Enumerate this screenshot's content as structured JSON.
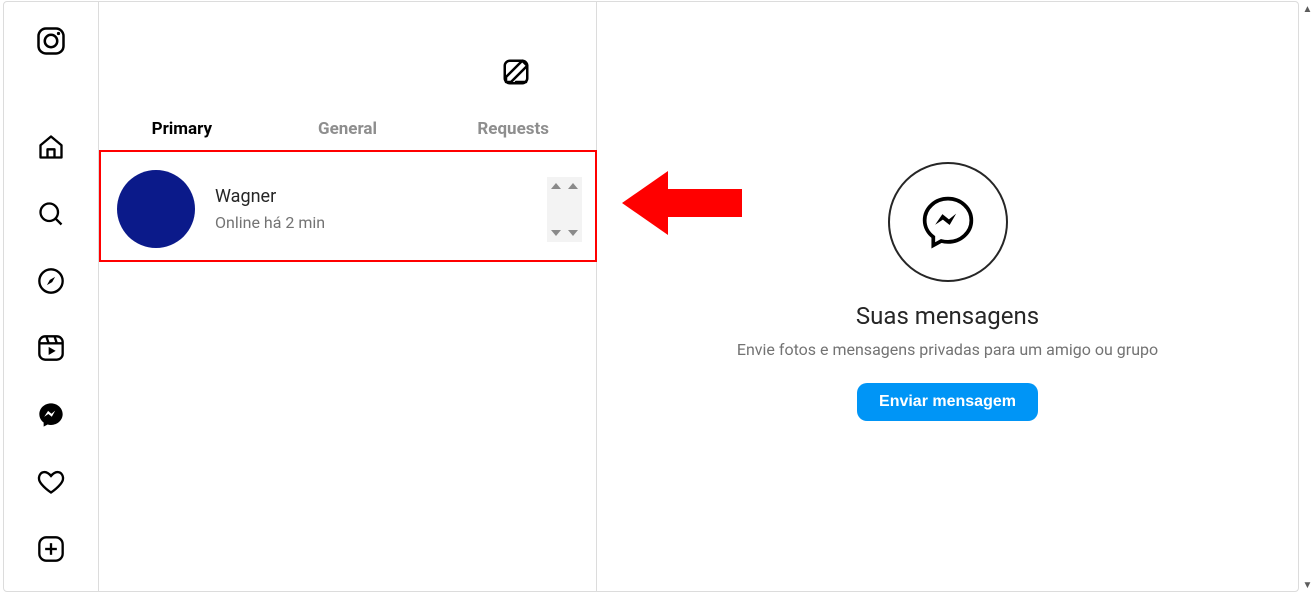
{
  "tabs": {
    "primary": "Primary",
    "general": "General",
    "requests": "Requests"
  },
  "threads": [
    {
      "name": "Wagner",
      "sub": "Online há 2 min"
    }
  ],
  "main": {
    "title": "Suas mensagens",
    "subtitle": "Envie fotos e mensagens privadas para um amigo ou grupo",
    "cta": "Enviar mensagem"
  }
}
